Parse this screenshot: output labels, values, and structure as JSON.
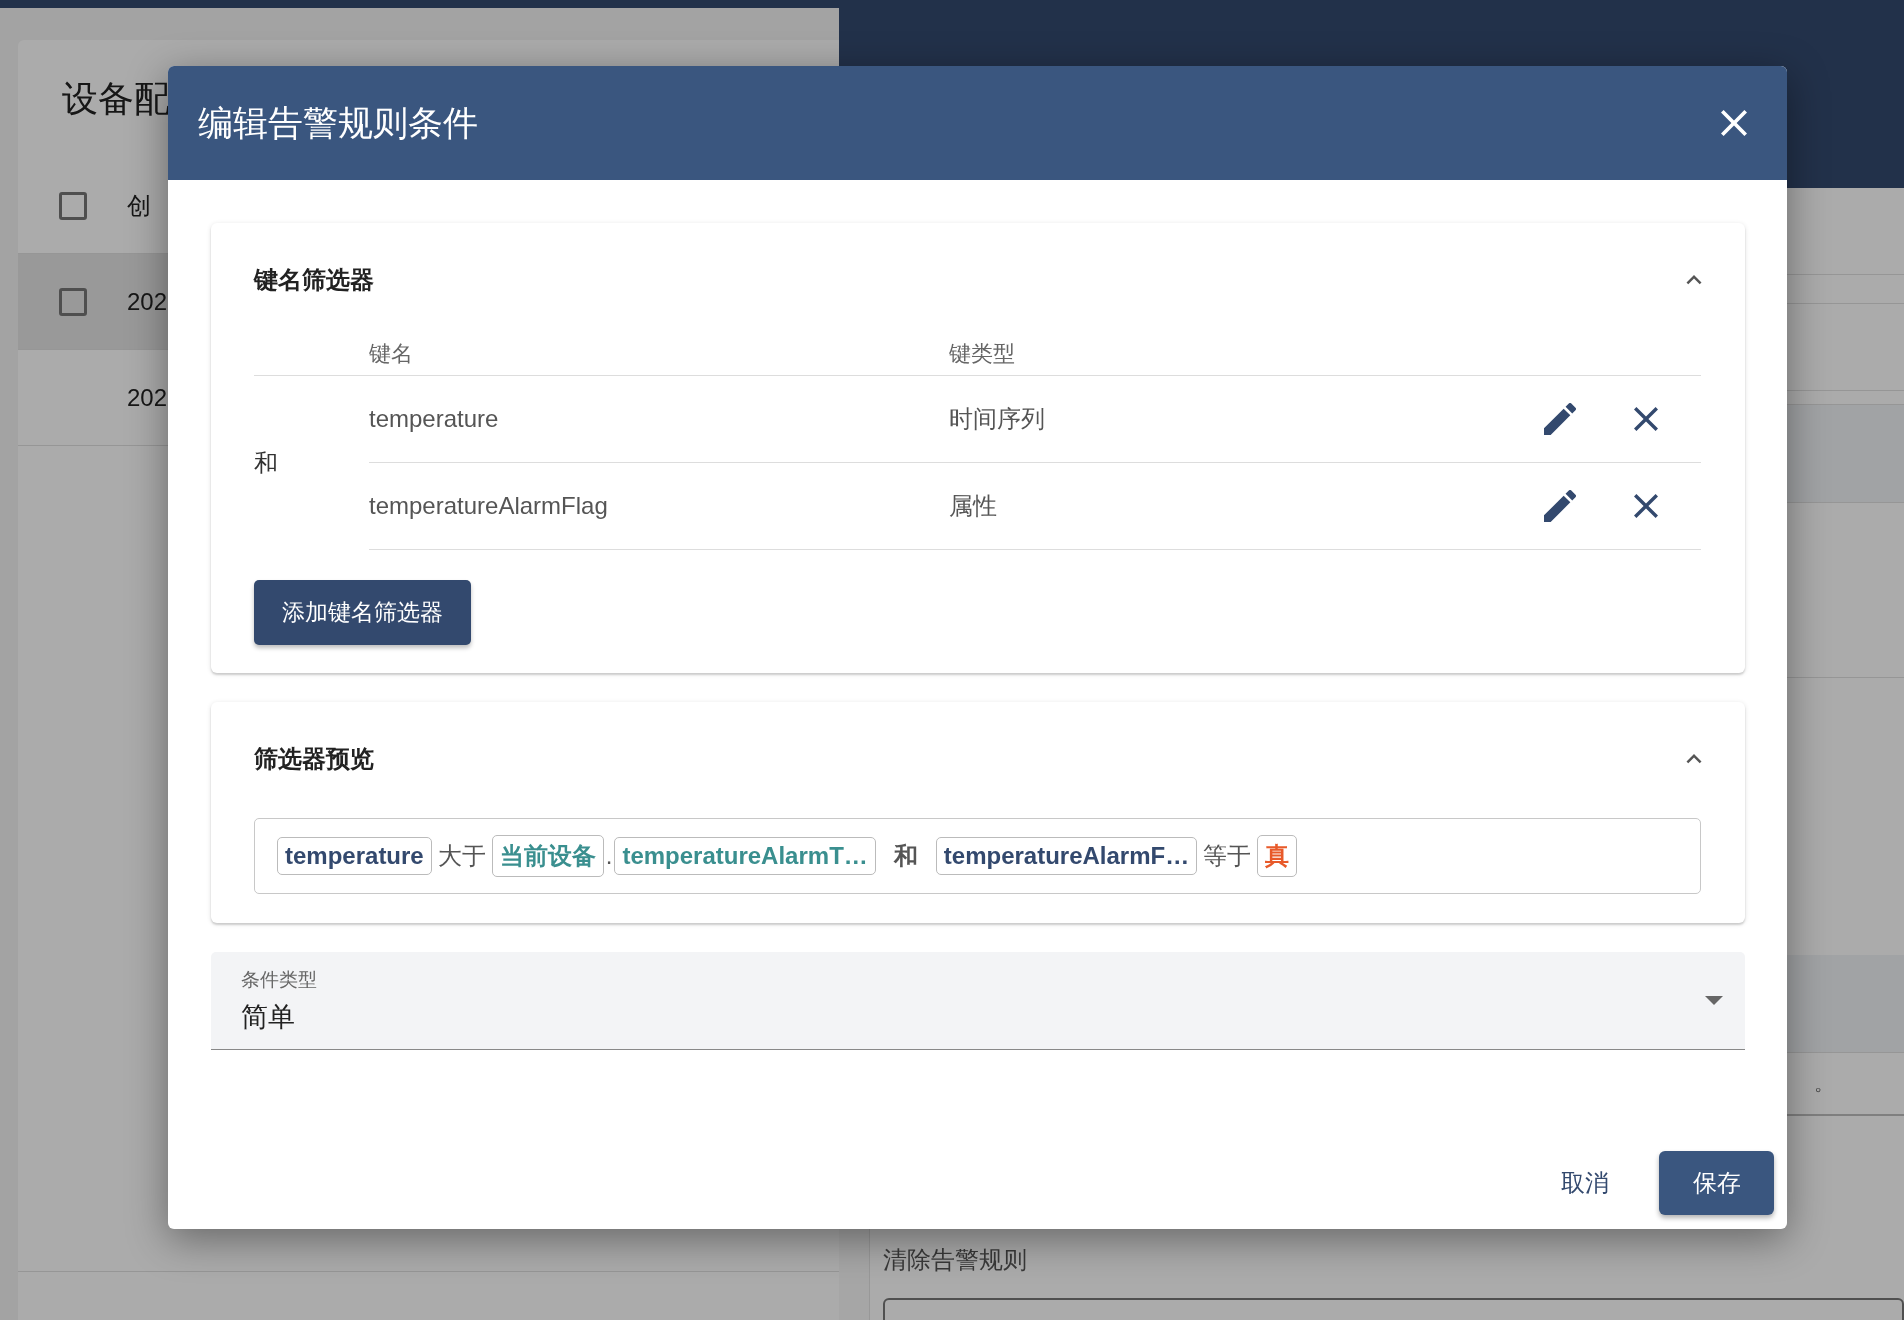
{
  "background": {
    "left_panel": {
      "title": "设备配",
      "header": {
        "label": "创",
        "checked": false
      },
      "rows": [
        {
          "kind": "checkbox",
          "checked": false,
          "highlighted": true,
          "text": "202"
        },
        {
          "kind": "plain",
          "highlighted": false,
          "text": "202"
        }
      ]
    },
    "right_panel": {
      "note": "。",
      "field_label": "清除告警规则"
    }
  },
  "dialog": {
    "title": "编辑告警规则条件",
    "key_filters": {
      "title": "键名筛选器",
      "expanded": true,
      "columns": [
        "键名",
        "键类型"
      ],
      "operator": "和",
      "rows": [
        {
          "key": "temperature",
          "type": "时间序列"
        },
        {
          "key": "temperatureAlarmFlag",
          "type": "属性"
        }
      ],
      "add_button": "添加键名筛选器"
    },
    "preview": {
      "title": "筛选器预览",
      "expanded": true,
      "tokens": [
        {
          "kind": "key",
          "text": "temperature"
        },
        {
          "kind": "op",
          "text": "大于"
        },
        {
          "kind": "source",
          "text": "当前设备"
        },
        {
          "kind": "dot",
          "text": "."
        },
        {
          "kind": "attr",
          "text": "temperatureAlarmT…"
        },
        {
          "kind": "join",
          "text": "和"
        },
        {
          "kind": "key",
          "text": "temperatureAlarmF…"
        },
        {
          "kind": "op",
          "text": "等于"
        },
        {
          "kind": "value",
          "text": "真"
        }
      ]
    },
    "condition_type": {
      "label": "条件类型",
      "value": "简单"
    },
    "buttons": {
      "cancel": "取消",
      "save": "保存"
    }
  }
}
